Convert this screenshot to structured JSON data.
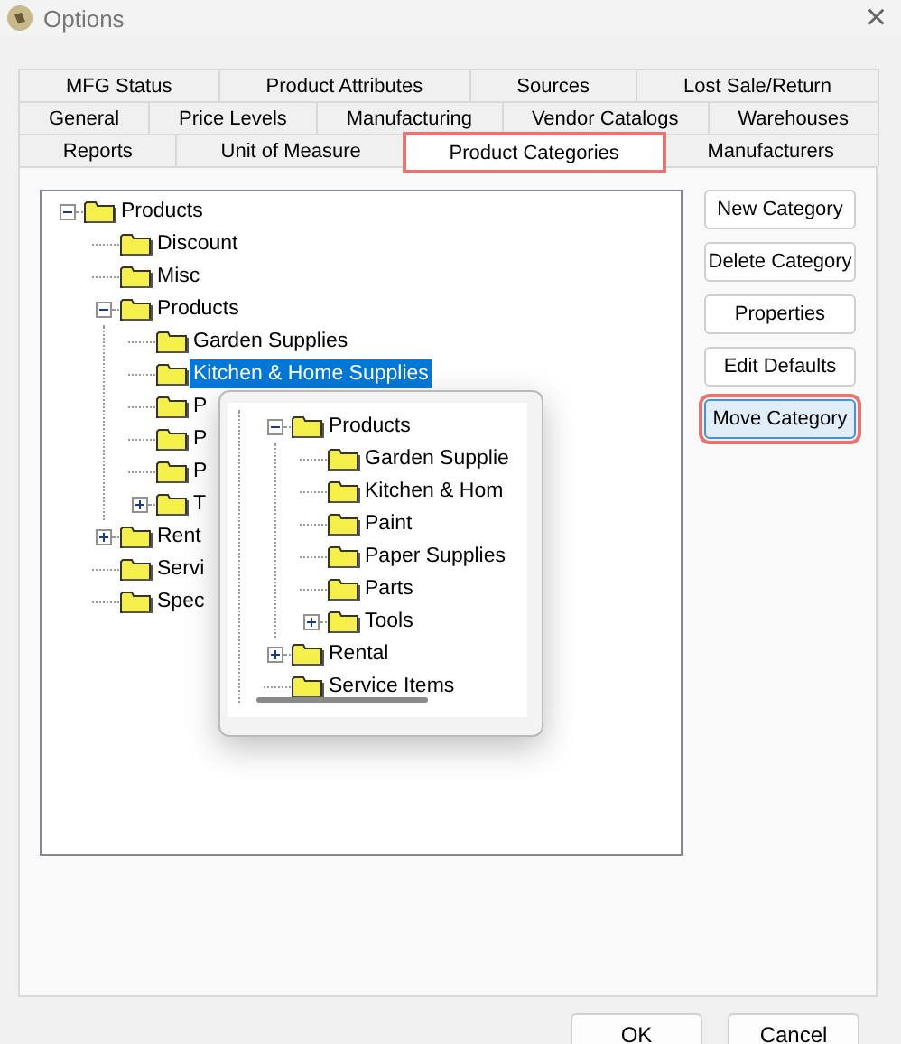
{
  "window": {
    "title": "Options",
    "close": "×"
  },
  "tab_rows": [
    [
      {
        "label": "MFG Status",
        "selected": false,
        "highlighted": false
      },
      {
        "label": "Product Attributes",
        "selected": false,
        "highlighted": false
      },
      {
        "label": "Sources",
        "selected": false,
        "highlighted": false
      },
      {
        "label": "Lost Sale/Return",
        "selected": false,
        "highlighted": false
      }
    ],
    [
      {
        "label": "General",
        "selected": false,
        "highlighted": false
      },
      {
        "label": "Price Levels",
        "selected": false,
        "highlighted": false
      },
      {
        "label": "Manufacturing",
        "selected": false,
        "highlighted": false
      },
      {
        "label": "Vendor Catalogs",
        "selected": false,
        "highlighted": false
      },
      {
        "label": "Warehouses",
        "selected": false,
        "highlighted": false
      }
    ],
    [
      {
        "label": "Reports",
        "selected": false,
        "highlighted": false
      },
      {
        "label": "Unit of Measure",
        "selected": false,
        "highlighted": false
      },
      {
        "label": "Product Categories",
        "selected": true,
        "highlighted": true
      },
      {
        "label": "Manufacturers",
        "selected": false,
        "highlighted": false
      }
    ]
  ],
  "tree": [
    {
      "label": "Products",
      "expanded": true,
      "selected": false,
      "children": [
        {
          "label": "Discount",
          "selected": false
        },
        {
          "label": "Misc",
          "selected": false
        },
        {
          "label": "Products",
          "expanded": true,
          "selected": false,
          "children": [
            {
              "label": "Garden Supplies",
              "selected": false
            },
            {
              "label": "Kitchen & Home Supplies",
              "selected": true
            },
            {
              "label": "P",
              "selected": false
            },
            {
              "label": "P",
              "selected": false
            },
            {
              "label": "P",
              "selected": false
            },
            {
              "label": "T",
              "expanded": false,
              "selected": false
            }
          ]
        },
        {
          "label": "Rent",
          "expanded": false,
          "selected": false
        },
        {
          "label": "Servi",
          "selected": false
        },
        {
          "label": "Spec",
          "selected": false
        }
      ]
    }
  ],
  "drop_popup": {
    "tree": [
      {
        "label": "Products",
        "expanded": true,
        "selected": false,
        "children": [
          {
            "label": "Garden Supplie",
            "selected": false
          },
          {
            "label": "Kitchen & Hom",
            "selected": false
          },
          {
            "label": "Paint",
            "selected": false
          },
          {
            "label": "Paper Supplies",
            "selected": false
          },
          {
            "label": "Parts",
            "selected": false
          },
          {
            "label": "Tools",
            "expanded": false,
            "selected": false
          }
        ]
      },
      {
        "label": "Rental",
        "expanded": false,
        "selected": false
      },
      {
        "label": "Service Items",
        "selected": false
      }
    ]
  },
  "buttons": [
    {
      "label": "New Category",
      "highlighted": false
    },
    {
      "label": "Delete Category",
      "highlighted": false
    },
    {
      "label": "Properties",
      "highlighted": false
    },
    {
      "label": "Edit Defaults",
      "highlighted": false
    },
    {
      "label": "Move Category",
      "highlighted": true
    }
  ],
  "footer_buttons": [
    "OK",
    "Cancel"
  ]
}
